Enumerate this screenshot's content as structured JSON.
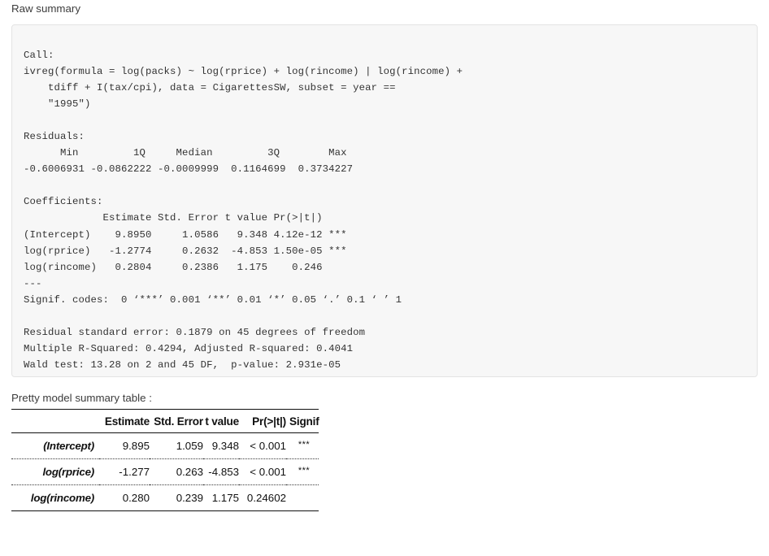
{
  "headings": {
    "raw_summary": "Raw summary",
    "pretty_table": "Pretty model summary table :"
  },
  "raw_summary": {
    "text": "Call:\nivreg(formula = log(packs) ~ log(rprice) + log(rincome) | log(rincome) +\n    tdiff + I(tax/cpi), data = CigarettesSW, subset = year ==\n    \"1995\")\n\nResiduals:\n      Min         1Q     Median         3Q        Max\n-0.6006931 -0.0862222 -0.0009999  0.1164699  0.3734227\n\nCoefficients:\n             Estimate Std. Error t value Pr(>|t|)\n(Intercept)    9.8950     1.0586   9.348 4.12e-12 ***\nlog(rprice)   -1.2774     0.2632  -4.853 1.50e-05 ***\nlog(rincome)   0.2804     0.2386   1.175    0.246\n---\nSignif. codes:  0 ‘***’ 0.001 ‘**’ 0.01 ‘*’ 0.05 ‘.’ 0.1 ‘ ’ 1\n\nResidual standard error: 0.1879 on 45 degrees of freedom\nMultiple R-Squared: 0.4294, Adjusted R-squared: 0.4041\nWald test: 13.28 on 2 and 45 DF,  p-value: 2.931e-05",
    "call_label": "Call:",
    "call_line_1": "ivreg(formula = log(packs) ~ log(rprice) + log(rincome) | log(rincome) +",
    "call_line_2": "    tdiff + I(tax/cpi), data = CigarettesSW, subset = year ==",
    "call_line_3": "    \"1995\")",
    "residuals_label": "Residuals:",
    "residuals_header": "      Min         1Q     Median         3Q        Max",
    "residuals_values": "-0.6006931 -0.0862222 -0.0009999  0.1164699  0.3734227",
    "coefficients_label": "Coefficients:",
    "coefficients_header": "             Estimate Std. Error t value Pr(>|t|)",
    "coefficients_row_1": "(Intercept)    9.8950     1.0586   9.348 4.12e-12 ***",
    "coefficients_row_2": "log(rprice)   -1.2774     0.2632  -4.853 1.50e-05 ***",
    "coefficients_row_3": "log(rincome)   0.2804     0.2386   1.175    0.246",
    "separator": "---",
    "signif_codes": "Signif. codes:  0 ‘***’ 0.001 ‘**’ 0.01 ‘*’ 0.05 ‘.’ 0.1 ‘ ’ 1",
    "residual_std_error": "Residual standard error: 0.1879 on 45 degrees of freedom",
    "r_squared": "Multiple R-Squared: 0.4294, Adjusted R-squared: 0.4041",
    "wald_test": "Wald test: 13.28 on 2 and 45 DF,  p-value: 2.931e-05"
  },
  "pretty_table": {
    "columns": [
      {
        "key": "term",
        "label": ""
      },
      {
        "key": "estimate",
        "label": "Estimate"
      },
      {
        "key": "std_error",
        "label": "Std. Error"
      },
      {
        "key": "t_value",
        "label": "t value"
      },
      {
        "key": "p_value",
        "label": "Pr(>|t|)"
      },
      {
        "key": "signif",
        "label": "Signif"
      }
    ],
    "rows": [
      {
        "term": "(Intercept)",
        "estimate": "9.895",
        "std_error": "1.059",
        "t_value": "9.348",
        "p_value": "< 0.001",
        "signif": "***"
      },
      {
        "term": "log(rprice)",
        "estimate": "-1.277",
        "std_error": "0.263",
        "t_value": "-4.853",
        "p_value": "< 0.001",
        "signif": "***"
      },
      {
        "term": "log(rincome)",
        "estimate": "0.280",
        "std_error": "0.239",
        "t_value": "1.175",
        "p_value": "0.24602",
        "signif": ""
      }
    ]
  },
  "colors": {
    "page_background": "#ffffff",
    "code_background": "#f7f7f7",
    "code_border": "#e3e3e3",
    "text": "#333333",
    "table_rule": "#111111"
  }
}
